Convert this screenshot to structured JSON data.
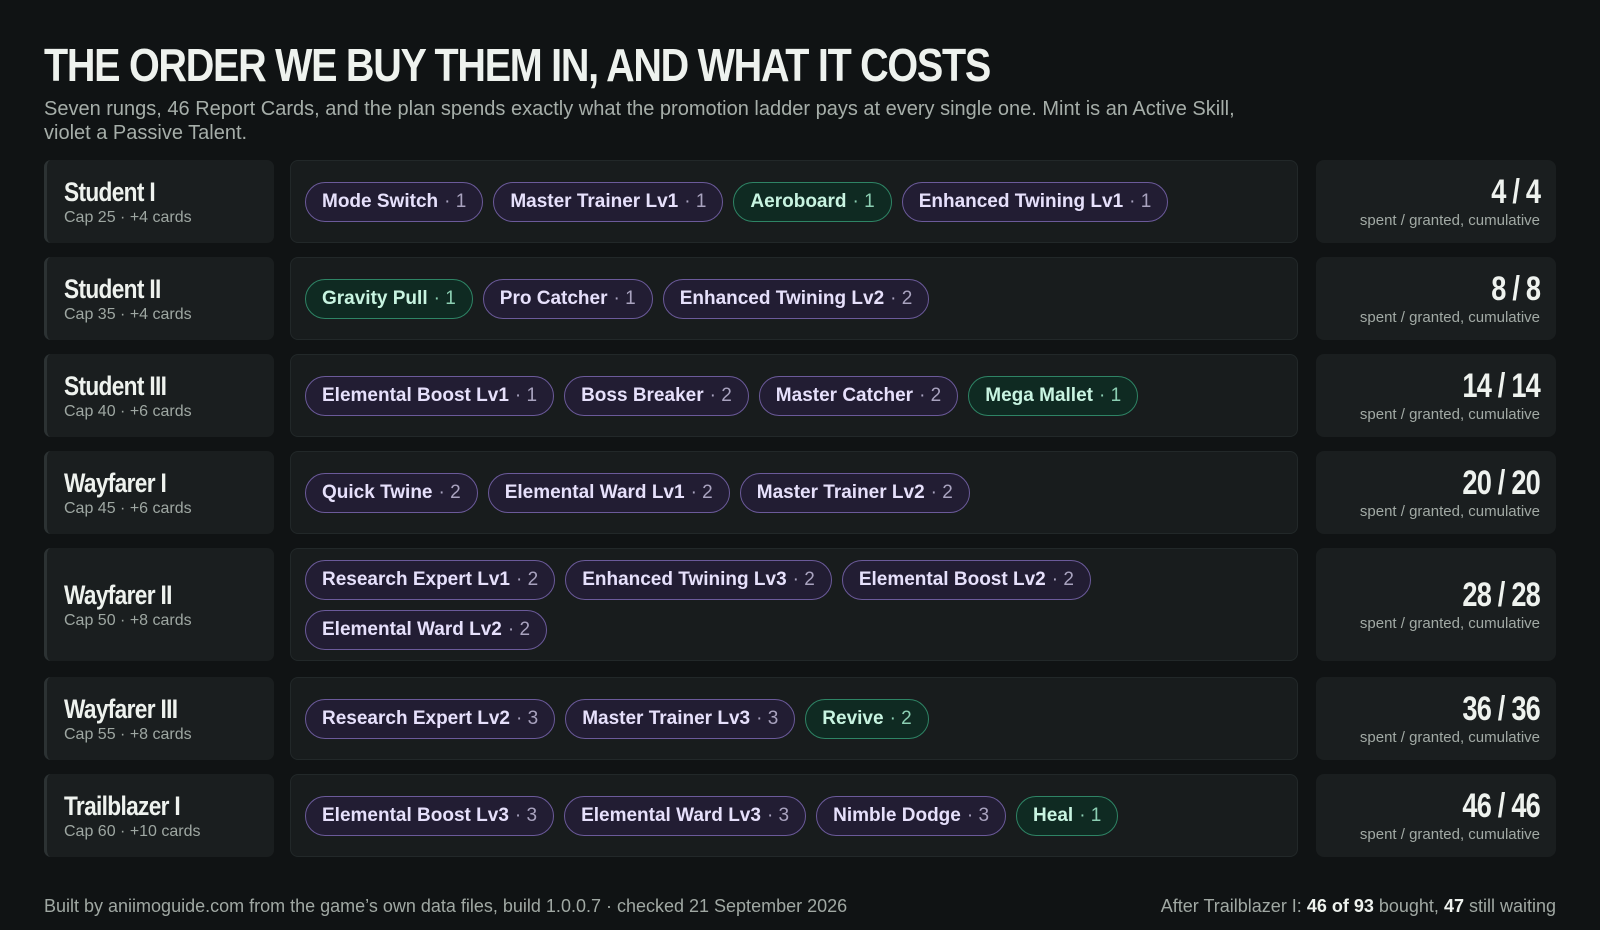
{
  "header": {
    "title": "THE ORDER WE BUY THEM IN, AND WHAT IT COSTS",
    "subtitle": "Seven rungs, 46 Report Cards, and the plan spends exactly what the promotion ladder pays at every single one. Mint is an Active Skill, violet a Passive Talent."
  },
  "colors": {
    "active_skill": "#2e8465",
    "passive_talent": "#6b5a9a",
    "background": "#101314"
  },
  "tally_label": "spent / granted, cumulative",
  "ranks": [
    {
      "name": "Student I",
      "meta": "Cap 25 · +4 cards",
      "tally": "4 / 4",
      "cards": [
        {
          "name": "Mode Switch",
          "cost": "· 1",
          "kind": "passive"
        },
        {
          "name": "Master Trainer Lv1",
          "cost": "· 1",
          "kind": "passive"
        },
        {
          "name": "Aeroboard",
          "cost": "· 1",
          "kind": "active"
        },
        {
          "name": "Enhanced Twining Lv1",
          "cost": "· 1",
          "kind": "passive"
        }
      ]
    },
    {
      "name": "Student II",
      "meta": "Cap 35 · +4 cards",
      "tally": "8 / 8",
      "cards": [
        {
          "name": "Gravity Pull",
          "cost": "· 1",
          "kind": "active"
        },
        {
          "name": "Pro Catcher",
          "cost": "· 1",
          "kind": "passive"
        },
        {
          "name": "Enhanced Twining Lv2",
          "cost": "· 2",
          "kind": "passive"
        }
      ]
    },
    {
      "name": "Student III",
      "meta": "Cap 40 · +6 cards",
      "tally": "14 / 14",
      "cards": [
        {
          "name": "Elemental Boost Lv1",
          "cost": "· 1",
          "kind": "passive"
        },
        {
          "name": "Boss Breaker",
          "cost": "· 2",
          "kind": "passive"
        },
        {
          "name": "Master Catcher",
          "cost": "· 2",
          "kind": "passive"
        },
        {
          "name": "Mega Mallet",
          "cost": "· 1",
          "kind": "active"
        }
      ]
    },
    {
      "name": "Wayfarer I",
      "meta": "Cap 45 · +6 cards",
      "tally": "20 / 20",
      "cards": [
        {
          "name": "Quick Twine",
          "cost": "· 2",
          "kind": "passive"
        },
        {
          "name": "Elemental Ward Lv1",
          "cost": "· 2",
          "kind": "passive"
        },
        {
          "name": "Master Trainer Lv2",
          "cost": "· 2",
          "kind": "passive"
        }
      ]
    },
    {
      "name": "Wayfarer II",
      "meta": "Cap 50 · +8 cards",
      "tally": "28 / 28",
      "cards": [
        {
          "name": "Research Expert Lv1",
          "cost": "· 2",
          "kind": "passive"
        },
        {
          "name": "Enhanced Twining Lv3",
          "cost": "· 2",
          "kind": "passive"
        },
        {
          "name": "Elemental Boost Lv2",
          "cost": "· 2",
          "kind": "passive"
        },
        {
          "name": "Elemental Ward Lv2",
          "cost": "· 2",
          "kind": "passive"
        }
      ]
    },
    {
      "name": "Wayfarer III",
      "meta": "Cap 55 · +8 cards",
      "tally": "36 / 36",
      "cards": [
        {
          "name": "Research Expert Lv2",
          "cost": "· 3",
          "kind": "passive"
        },
        {
          "name": "Master Trainer Lv3",
          "cost": "· 3",
          "kind": "passive"
        },
        {
          "name": "Revive",
          "cost": "· 2",
          "kind": "active"
        }
      ]
    },
    {
      "name": "Trailblazer I",
      "meta": "Cap 60 · +10 cards",
      "tally": "46 / 46",
      "cards": [
        {
          "name": "Elemental Boost Lv3",
          "cost": "· 3",
          "kind": "passive"
        },
        {
          "name": "Elemental Ward Lv3",
          "cost": "· 3",
          "kind": "passive"
        },
        {
          "name": "Nimble Dodge",
          "cost": "· 3",
          "kind": "passive"
        },
        {
          "name": "Heal",
          "cost": "· 1",
          "kind": "active"
        }
      ]
    }
  ],
  "footer": {
    "source": "Built by aniimoguide.com from the game’s own data files, build 1.0.0.7 · checked 21 September 2026",
    "summary_prefix": "After Trailblazer I: ",
    "summary_bought": "46 of 93",
    "summary_middle": " bought, ",
    "summary_waiting": "47",
    "summary_suffix": " still waiting"
  }
}
